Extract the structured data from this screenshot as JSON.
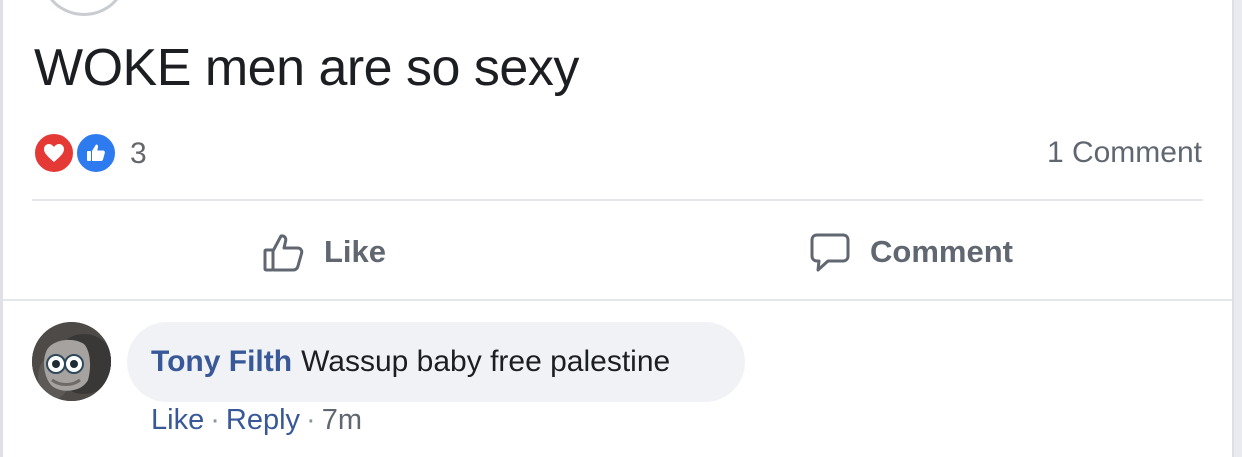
{
  "post": {
    "text": "WOKE men are so sexy",
    "reaction_icons": [
      "heart-icon",
      "thumbs-up-icon"
    ],
    "reaction_count": "3",
    "comment_count": "1 Comment"
  },
  "actions": {
    "like_label": "Like",
    "comment_label": "Comment"
  },
  "comment": {
    "author": "Tony Filth",
    "text": "Wassup baby free palestine",
    "like_label": "Like",
    "reply_label": "Reply",
    "separator": "·",
    "time": "7m"
  },
  "colors": {
    "link_blue": "#385898",
    "love_red": "#e53935",
    "like_blue": "#2e7bf0",
    "muted_text": "#606770",
    "bubble_bg": "#f0f2f5"
  }
}
